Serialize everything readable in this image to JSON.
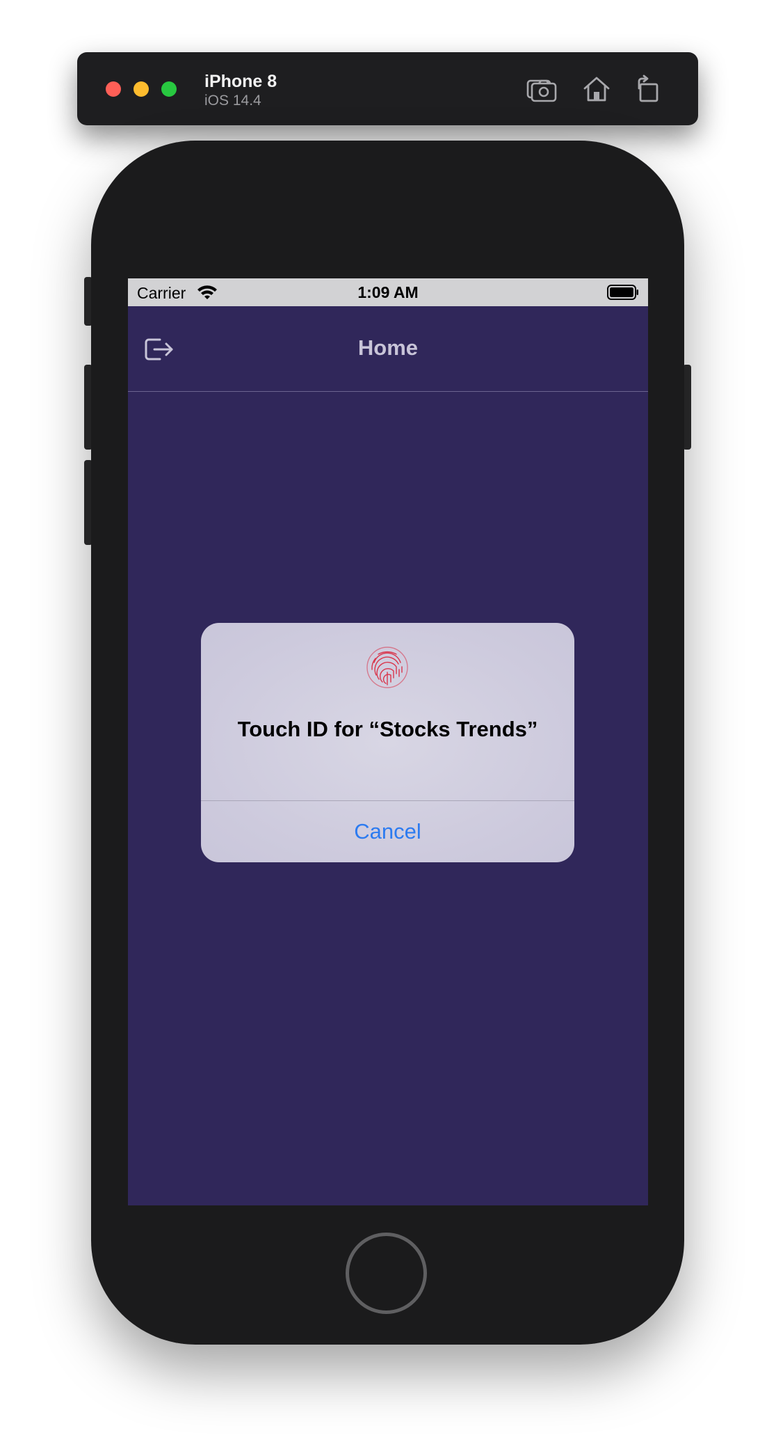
{
  "simulator": {
    "device_name": "iPhone 8",
    "os_version": "iOS 14.4",
    "toolbar_icons": [
      "screenshot-icon",
      "home-icon",
      "rotate-icon"
    ]
  },
  "status_bar": {
    "carrier": "Carrier",
    "time": "1:09 AM",
    "icons": [
      "wifi-icon",
      "battery-icon"
    ]
  },
  "nav": {
    "title": "Home",
    "left_icon": "logout-icon"
  },
  "alert": {
    "icon": "fingerprint-icon",
    "title": "Touch ID for “Stocks Trends”",
    "cancel_label": "Cancel"
  },
  "colors": {
    "screen_background": "#30275a",
    "alert_background": "#cdcadd",
    "cancel_text": "#2c7bf0",
    "fingerprint": "#d9354b"
  }
}
